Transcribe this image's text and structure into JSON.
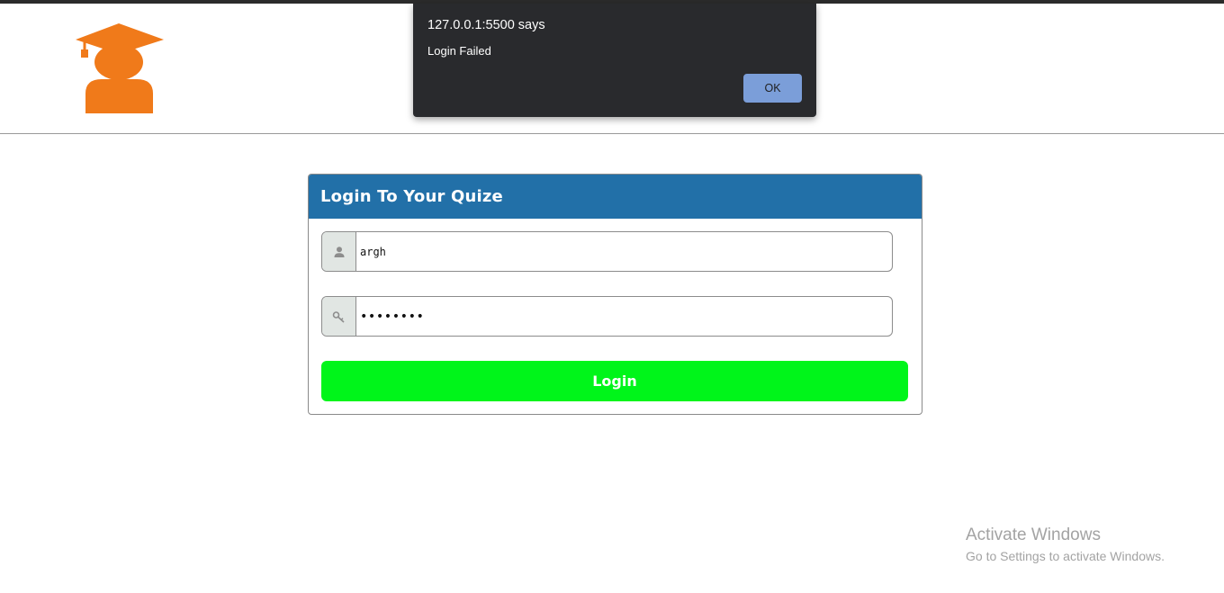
{
  "dialog": {
    "title": "127.0.0.1:5500 says",
    "message": "Login Failed",
    "ok_label": "OK"
  },
  "login_card": {
    "title": "Login To Your Quize",
    "username": {
      "value": "argh",
      "icon": "user-icon"
    },
    "password": {
      "value": "argh1234",
      "icon": "key-icon"
    },
    "login_label": "Login"
  },
  "logo": {
    "icon": "graduate-icon",
    "color": "#f07a1a"
  },
  "watermark": {
    "title": "Activate Windows",
    "subtitle": "Go to Settings to activate Windows."
  },
  "colors": {
    "card_header": "#2270a8",
    "login_button": "#00f51a",
    "dialog_background": "#292a2d",
    "dialog_button": "#7b9ed9"
  }
}
